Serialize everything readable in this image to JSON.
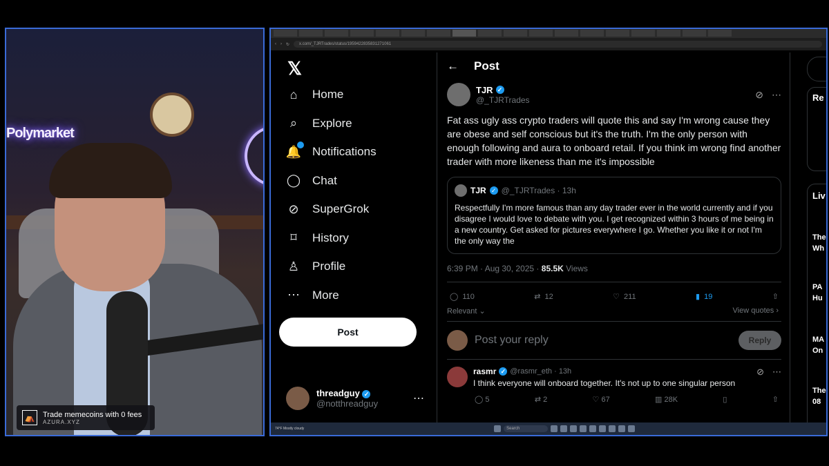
{
  "overlay": {
    "banner_title": "Trade memecoins with 0 fees",
    "banner_sub": "AZURA.XYZ",
    "neon_sign": "Polymarket"
  },
  "browser": {
    "tabs": [
      "",
      "",
      "",
      "",
      "",
      "",
      "",
      "",
      "",
      "",
      "",
      "",
      "",
      "",
      "",
      "",
      "",
      ""
    ],
    "url": "x.com/_TJRTrades/status/1959422835831271061"
  },
  "nav": {
    "logo": "𝕏",
    "items": [
      {
        "label": "Home",
        "icon": "home-icon",
        "glyph": "⌂"
      },
      {
        "label": "Explore",
        "icon": "search-icon",
        "glyph": "⌕"
      },
      {
        "label": "Notifications",
        "icon": "bell-icon",
        "glyph": "🔔"
      },
      {
        "label": "Chat",
        "icon": "chat-icon",
        "glyph": "◯"
      },
      {
        "label": "SuperGrok",
        "icon": "grok-icon",
        "glyph": "⊘"
      },
      {
        "label": "History",
        "icon": "bookmark-icon",
        "glyph": "⌑"
      },
      {
        "label": "Profile",
        "icon": "person-icon",
        "glyph": "♙"
      },
      {
        "label": "More",
        "icon": "more-circle-icon",
        "glyph": "⋯"
      }
    ],
    "post_button": "Post",
    "account": {
      "name": "threadguy",
      "handle": "@notthreadguy"
    }
  },
  "header": {
    "back": "←",
    "title": "Post"
  },
  "tweet": {
    "name": "TJR",
    "handle": "@_TJRTrades",
    "text": "Fat ass ugly ass crypto traders will quote this and say I'm wrong cause they are obese and self conscious but it's the truth. I'm the only person with enough following and aura to onboard retail. If you think im wrong find another trader with more likeness than me it's impossible",
    "quote": {
      "name": "TJR",
      "handle": "@_TJRTrades · 13h",
      "text": "Respectfully I'm more famous than any day trader ever in the world currently and if you disagree I would love to debate with you. I get recognized within 3 hours of me being in a new country. Get asked for pictures everywhere I go. Whether you like it or not I'm the only way the"
    },
    "time": "6:39 PM · Aug 30, 2025 · ",
    "views_count": "85.5K",
    "views_label": " Views",
    "stats": {
      "replies": "110",
      "reposts": "12",
      "likes": "211",
      "bookmarks": "19"
    },
    "relevant": "Relevant",
    "view_quotes": "View quotes"
  },
  "reply_box": {
    "placeholder": "Post your reply",
    "button": "Reply"
  },
  "comment": {
    "name": "rasmr",
    "handle": "@rasmr_eth · 13h",
    "text": "I think everyone will onboard together. It's not up to one singular person",
    "stats": {
      "replies": "5",
      "reposts": "2",
      "likes": "67",
      "views": "28K"
    }
  },
  "sidebar_right": {
    "r1": "Re",
    "r2": "Liv",
    "r3": "The",
    "r4": "Wh",
    "r5": "PA",
    "r6": "Hu",
    "r7": "MA",
    "r8": "On",
    "r9": "The",
    "r10": "08"
  },
  "taskbar": {
    "search": "Search",
    "weather": "74°F Mostly cloudy"
  }
}
